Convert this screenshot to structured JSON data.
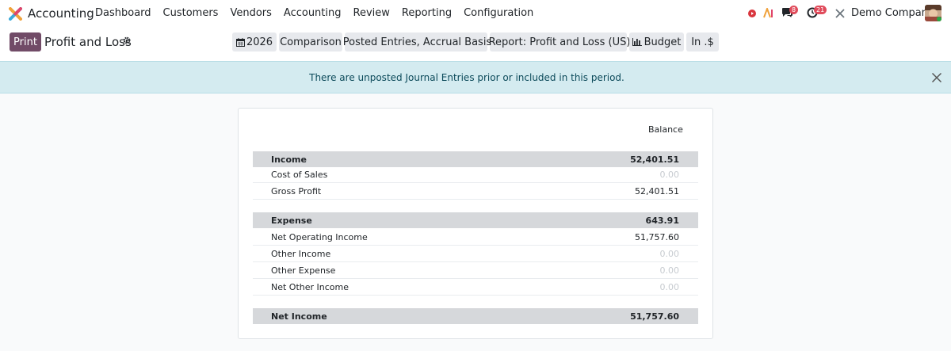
{
  "navbar": {
    "app_name": "Accounting",
    "menu": [
      "Dashboard",
      "Customers",
      "Vendors",
      "Accounting",
      "Review",
      "Reporting",
      "Configuration"
    ],
    "messages_count": "8",
    "activities_count": "21",
    "company": "Demo Company"
  },
  "control": {
    "print_label": "Print",
    "title": "Profit and Loss",
    "filters": {
      "year": "2026",
      "comparison": "Comparison",
      "entries": "Posted Entries, Accrual Basis",
      "report": "Report: Profit and Loss (US)",
      "budget": "Budget",
      "currency": "In .$"
    }
  },
  "alert": {
    "text": "There are unposted Journal Entries prior or included in this period."
  },
  "report": {
    "column": "Balance",
    "rows": [
      {
        "label": "Income",
        "value": "52,401.51"
      },
      {
        "label": "Cost of Sales",
        "value": "0.00"
      },
      {
        "label": "Gross Profit",
        "value": "52,401.51"
      },
      {
        "label": "Expense",
        "value": "643.91"
      },
      {
        "label": "Net Operating Income",
        "value": "51,757.60"
      },
      {
        "label": "Other Income",
        "value": "0.00"
      },
      {
        "label": "Other Expense",
        "value": "0.00"
      },
      {
        "label": "Net Other Income",
        "value": "0.00"
      },
      {
        "label": "Net Income",
        "value": "51,757.60"
      }
    ]
  },
  "colors": {
    "brand": "#714b67",
    "alert_bg": "#d4ebf0",
    "badge": "#e04b5b"
  }
}
